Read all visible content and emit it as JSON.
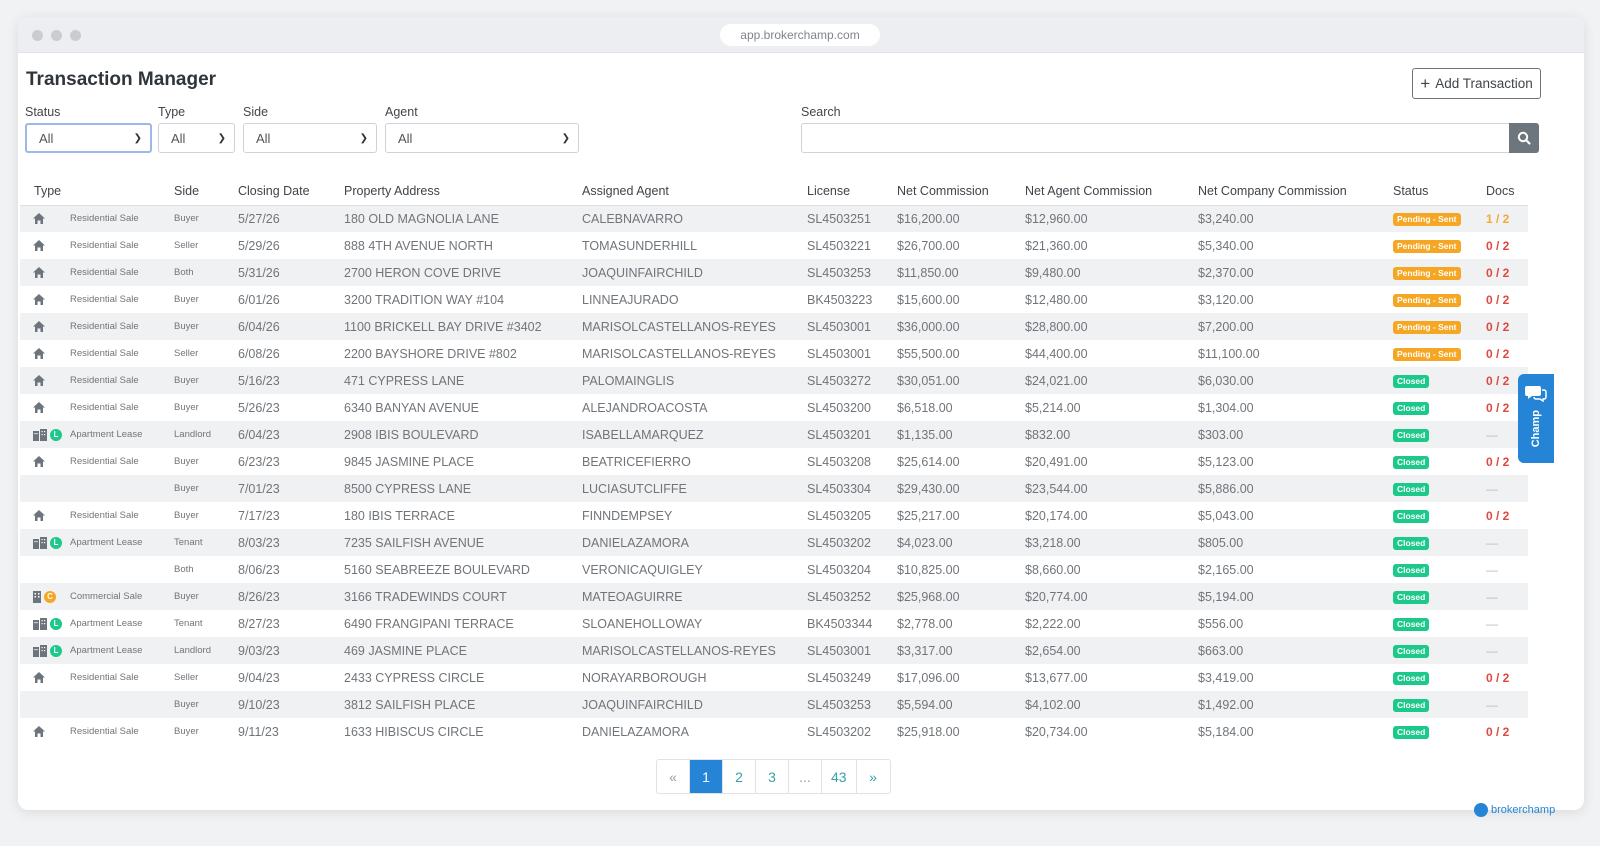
{
  "browser": {
    "url": "app.brokerchamp.com"
  },
  "page": {
    "title": "Transaction Manager",
    "add_button": "Add Transaction"
  },
  "filters": {
    "status": {
      "label": "Status",
      "value": "All"
    },
    "type": {
      "label": "Type",
      "value": "All"
    },
    "side": {
      "label": "Side",
      "value": "All"
    },
    "agent": {
      "label": "Agent",
      "value": "All"
    },
    "search": {
      "label": "Search",
      "value": ""
    }
  },
  "table": {
    "headers": [
      "Type",
      "Side",
      "Closing Date",
      "Property Address",
      "Assigned Agent",
      "License",
      "Net Commission",
      "Net Agent Commission",
      "Net Company Commission",
      "Status",
      "Docs"
    ],
    "rows": [
      {
        "icon": "house",
        "letter": "",
        "type": "Residential Sale",
        "side": "Buyer",
        "date": "5/27/26",
        "address": "180 OLD MAGNOLIA LANE",
        "agent": "CALEBNAVARRO",
        "license": "SL4503251",
        "net": "$16,200.00",
        "agent_comm": "$12,960.00",
        "company": "$3,240.00",
        "status": "Pending - Sent",
        "status_kind": "pending",
        "docs": "1 / 2",
        "docs_kind": "orange"
      },
      {
        "icon": "house",
        "letter": "",
        "type": "Residential Sale",
        "side": "Seller",
        "date": "5/29/26",
        "address": "888 4TH AVENUE NORTH",
        "agent": "TOMASUNDERHILL",
        "license": "SL4503221",
        "net": "$26,700.00",
        "agent_comm": "$21,360.00",
        "company": "$5,340.00",
        "status": "Pending - Sent",
        "status_kind": "pending",
        "docs": "0 / 2",
        "docs_kind": "red"
      },
      {
        "icon": "house",
        "letter": "",
        "type": "Residential Sale",
        "side": "Both",
        "date": "5/31/26",
        "address": "2700 HERON COVE DRIVE",
        "agent": "JOAQUINFAIRCHILD",
        "license": "SL4503253",
        "net": "$11,850.00",
        "agent_comm": "$9,480.00",
        "company": "$2,370.00",
        "status": "Pending - Sent",
        "status_kind": "pending",
        "docs": "0 / 2",
        "docs_kind": "red"
      },
      {
        "icon": "house",
        "letter": "",
        "type": "Residential Sale",
        "side": "Buyer",
        "date": "6/01/26",
        "address": "3200 TRADITION WAY #104",
        "agent": "LINNEAJURADO",
        "license": "BK4503223",
        "net": "$15,600.00",
        "agent_comm": "$12,480.00",
        "company": "$3,120.00",
        "status": "Pending - Sent",
        "status_kind": "pending",
        "docs": "0 / 2",
        "docs_kind": "red"
      },
      {
        "icon": "house",
        "letter": "",
        "type": "Residential Sale",
        "side": "Buyer",
        "date": "6/04/26",
        "address": "1100 BRICKELL BAY DRIVE #3402",
        "agent": "MARISOLCASTELLANOS-REYES",
        "license": "SL4503001",
        "net": "$36,000.00",
        "agent_comm": "$28,800.00",
        "company": "$7,200.00",
        "status": "Pending - Sent",
        "status_kind": "pending",
        "docs": "0 / 2",
        "docs_kind": "red"
      },
      {
        "icon": "house",
        "letter": "",
        "type": "Residential Sale",
        "side": "Seller",
        "date": "6/08/26",
        "address": "2200 BAYSHORE DRIVE #802",
        "agent": "MARISOLCASTELLANOS-REYES",
        "license": "SL4503001",
        "net": "$55,500.00",
        "agent_comm": "$44,400.00",
        "company": "$11,100.00",
        "status": "Pending - Sent",
        "status_kind": "pending",
        "docs": "0 / 2",
        "docs_kind": "red"
      },
      {
        "icon": "house",
        "letter": "",
        "type": "Residential Sale",
        "side": "Buyer",
        "date": "5/16/23",
        "address": "471 CYPRESS LANE",
        "agent": "PALOMAINGLIS",
        "license": "SL4503272",
        "net": "$30,051.00",
        "agent_comm": "$24,021.00",
        "company": "$6,030.00",
        "status": "Closed",
        "status_kind": "closed",
        "docs": "0 / 2",
        "docs_kind": "red"
      },
      {
        "icon": "house",
        "letter": "",
        "type": "Residential Sale",
        "side": "Buyer",
        "date": "5/26/23",
        "address": "6340 BANYAN AVENUE",
        "agent": "ALEJANDROACOSTA",
        "license": "SL4503200",
        "net": "$6,518.00",
        "agent_comm": "$5,214.00",
        "company": "$1,304.00",
        "status": "Closed",
        "status_kind": "closed",
        "docs": "0 / 2",
        "docs_kind": "red"
      },
      {
        "icon": "apartment",
        "letter": "L",
        "type": "Apartment Lease",
        "side": "Landlord",
        "date": "6/04/23",
        "address": "2908 IBIS BOULEVARD",
        "agent": "ISABELLAMARQUEZ",
        "license": "SL4503201",
        "net": "$1,135.00",
        "agent_comm": "$832.00",
        "company": "$303.00",
        "status": "Closed",
        "status_kind": "closed",
        "docs": "—",
        "docs_kind": "dash"
      },
      {
        "icon": "house",
        "letter": "",
        "type": "Residential Sale",
        "side": "Buyer",
        "date": "6/23/23",
        "address": "9845 JASMINE PLACE",
        "agent": "BEATRICEFIERRO",
        "license": "SL4503208",
        "net": "$25,614.00",
        "agent_comm": "$20,491.00",
        "company": "$5,123.00",
        "status": "Closed",
        "status_kind": "closed",
        "docs": "0 / 2",
        "docs_kind": "red"
      },
      {
        "icon": "",
        "letter": "",
        "type": "",
        "side": "Buyer",
        "date": "7/01/23",
        "address": "8500 CYPRESS LANE",
        "agent": "LUCIASUTCLIFFE",
        "license": "SL4503304",
        "net": "$29,430.00",
        "agent_comm": "$23,544.00",
        "company": "$5,886.00",
        "status": "Closed",
        "status_kind": "closed",
        "docs": "—",
        "docs_kind": "dash"
      },
      {
        "icon": "house",
        "letter": "",
        "type": "Residential Sale",
        "side": "Buyer",
        "date": "7/17/23",
        "address": "180 IBIS TERRACE",
        "agent": "FINNDEMPSEY",
        "license": "SL4503205",
        "net": "$25,217.00",
        "agent_comm": "$20,174.00",
        "company": "$5,043.00",
        "status": "Closed",
        "status_kind": "closed",
        "docs": "0 / 2",
        "docs_kind": "red"
      },
      {
        "icon": "apartment",
        "letter": "L",
        "type": "Apartment Lease",
        "side": "Tenant",
        "date": "8/03/23",
        "address": "7235 SAILFISH AVENUE",
        "agent": "DANIELAZAMORA",
        "license": "SL4503202",
        "net": "$4,023.00",
        "agent_comm": "$3,218.00",
        "company": "$805.00",
        "status": "Closed",
        "status_kind": "closed",
        "docs": "—",
        "docs_kind": "dash"
      },
      {
        "icon": "",
        "letter": "",
        "type": "",
        "side": "Both",
        "date": "8/06/23",
        "address": "5160 SEABREEZE BOULEVARD",
        "agent": "VERONICAQUIGLEY",
        "license": "SL4503204",
        "net": "$10,825.00",
        "agent_comm": "$8,660.00",
        "company": "$2,165.00",
        "status": "Closed",
        "status_kind": "closed",
        "docs": "—",
        "docs_kind": "dash"
      },
      {
        "icon": "building",
        "letter": "C",
        "type": "Commercial Sale",
        "side": "Buyer",
        "date": "8/26/23",
        "address": "3166 TRADEWINDS COURT",
        "agent": "MATEOAGUIRRE",
        "license": "SL4503252",
        "net": "$25,968.00",
        "agent_comm": "$20,774.00",
        "company": "$5,194.00",
        "status": "Closed",
        "status_kind": "closed",
        "docs": "—",
        "docs_kind": "dash"
      },
      {
        "icon": "apartment",
        "letter": "L",
        "type": "Apartment Lease",
        "side": "Tenant",
        "date": "8/27/23",
        "address": "6490 FRANGIPANI TERRACE",
        "agent": "SLOANEHOLLOWAY",
        "license": "BK4503344",
        "net": "$2,778.00",
        "agent_comm": "$2,222.00",
        "company": "$556.00",
        "status": "Closed",
        "status_kind": "closed",
        "docs": "—",
        "docs_kind": "dash"
      },
      {
        "icon": "apartment",
        "letter": "L",
        "type": "Apartment Lease",
        "side": "Landlord",
        "date": "9/03/23",
        "address": "469 JASMINE PLACE",
        "agent": "MARISOLCASTELLANOS-REYES",
        "license": "SL4503001",
        "net": "$3,317.00",
        "agent_comm": "$2,654.00",
        "company": "$663.00",
        "status": "Closed",
        "status_kind": "closed",
        "docs": "—",
        "docs_kind": "dash"
      },
      {
        "icon": "house",
        "letter": "",
        "type": "Residential Sale",
        "side": "Seller",
        "date": "9/04/23",
        "address": "2433 CYPRESS CIRCLE",
        "agent": "NORAYARBOROUGH",
        "license": "SL4503249",
        "net": "$17,096.00",
        "agent_comm": "$13,677.00",
        "company": "$3,419.00",
        "status": "Closed",
        "status_kind": "closed",
        "docs": "0 / 2",
        "docs_kind": "red"
      },
      {
        "icon": "",
        "letter": "",
        "type": "",
        "side": "Buyer",
        "date": "9/10/23",
        "address": "3812 SAILFISH PLACE",
        "agent": "JOAQUINFAIRCHILD",
        "license": "SL4503253",
        "net": "$5,594.00",
        "agent_comm": "$4,102.00",
        "company": "$1,492.00",
        "status": "Closed",
        "status_kind": "closed",
        "docs": "—",
        "docs_kind": "dash"
      },
      {
        "icon": "house",
        "letter": "",
        "type": "Residential Sale",
        "side": "Buyer",
        "date": "9/11/23",
        "address": "1633 HIBISCUS CIRCLE",
        "agent": "DANIELAZAMORA",
        "license": "SL4503202",
        "net": "$25,918.00",
        "agent_comm": "$20,734.00",
        "company": "$5,184.00",
        "status": "Closed",
        "status_kind": "closed",
        "docs": "0 / 2",
        "docs_kind": "red"
      }
    ]
  },
  "pagination": {
    "prev": "«",
    "next": "»",
    "pages": [
      {
        "label": "1",
        "active": true
      },
      {
        "label": "2",
        "active": false
      },
      {
        "label": "3",
        "active": false
      },
      {
        "label": "...",
        "active": false
      },
      {
        "label": "43",
        "active": false
      }
    ]
  },
  "chat_widget": {
    "label": "Champ"
  },
  "branding": {
    "name": "brokerchamp"
  },
  "colors": {
    "pending": "#f5a623",
    "closed": "#1cc88a",
    "lease_badge": "#1cc88a",
    "commercial_badge": "#f5a623",
    "accent": "#2584d6"
  }
}
